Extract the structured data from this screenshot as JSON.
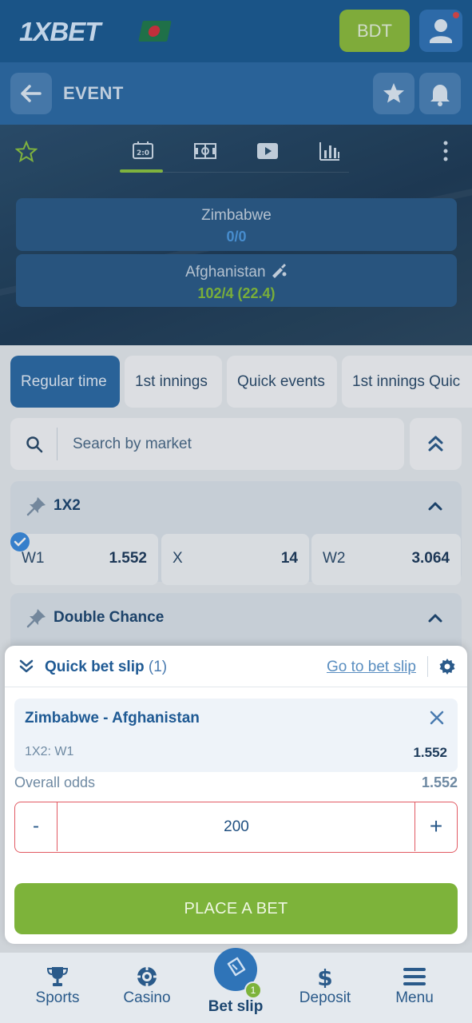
{
  "header": {
    "logo_text": "1XBET",
    "currency_button": "BDT"
  },
  "event_bar": {
    "title": "EVENT"
  },
  "scoreboard": {
    "team1": {
      "name": "Zimbabwe",
      "score": "0/0"
    },
    "team2": {
      "name": "Afghanistan",
      "score": "102/4 (22.4)"
    }
  },
  "period_tabs": [
    "Regular time",
    "1st innings",
    "Quick events",
    "1st innings Quic"
  ],
  "search": {
    "placeholder": "Search by market"
  },
  "markets": {
    "m1x2": {
      "title": "1X2",
      "odds": [
        {
          "label": "W1",
          "value": "1.552",
          "selected": true
        },
        {
          "label": "X",
          "value": "14",
          "selected": false
        },
        {
          "label": "W2",
          "value": "3.064",
          "selected": false
        }
      ]
    },
    "double_chance": {
      "title": "Double Chance"
    }
  },
  "quick_bet_slip": {
    "title": "Quick bet slip",
    "count": "(1)",
    "go_link": "Go to bet slip",
    "bet": {
      "match": "Zimbabwe - Afghanistan",
      "market": "1X2: W1",
      "odd": "1.552"
    },
    "overall_label": "Overall odds",
    "overall_value": "1.552",
    "stake": {
      "minus": "-",
      "value": "200",
      "plus": "+"
    },
    "place_button": "PLACE A BET"
  },
  "bottom_nav": {
    "sports": "Sports",
    "casino": "Casino",
    "betslip": "Bet slip",
    "betslip_badge": "1",
    "deposit": "Deposit",
    "menu": "Menu"
  },
  "colors": {
    "brand_blue": "#1a5a92",
    "accent_green": "#7db33a",
    "error_red": "#e25a63"
  }
}
